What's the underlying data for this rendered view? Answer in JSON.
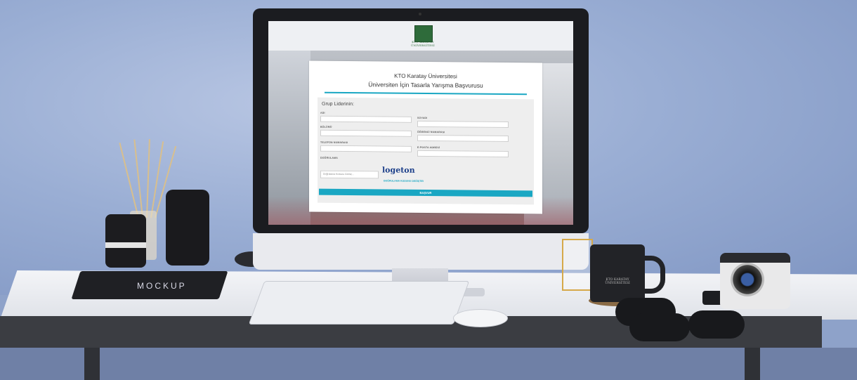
{
  "screen": {
    "logo_text": "KTO KARATAY ÜNİVERSİTESİ",
    "title": "KTO Karatay Üniversitesi",
    "subtitle": "Üniversiten İçin Tasarla Yarışma Başvurusu",
    "group_heading": "Grup Liderinin:",
    "fields": {
      "ad": "ADI",
      "soyad": "SOYADI",
      "bolum": "BÖLÜMÜ",
      "ogrenci_no": "ÖĞRENCİ NUMARASI",
      "telefon": "TELEFON NUMARASI",
      "eposta": "E-POSTA ADRESİ",
      "dogrulama": "DOĞRULAMA"
    },
    "captcha_placeholder": "Doğrulama Kodunu Giriniz...",
    "captcha_text": "logeton",
    "captcha_refresh": "DOĞRULAMA KODUNU DEĞİŞTİR",
    "submit_label": "BAŞVUR"
  },
  "props": {
    "notebook_text": "MOCKUP",
    "mug_text": "KTO KARATAY ÜNİVERSİTESİ"
  },
  "colors": {
    "accent": "#1aa7c3",
    "wall": "#9aaed4",
    "brand_green": "#2e6b3a"
  }
}
